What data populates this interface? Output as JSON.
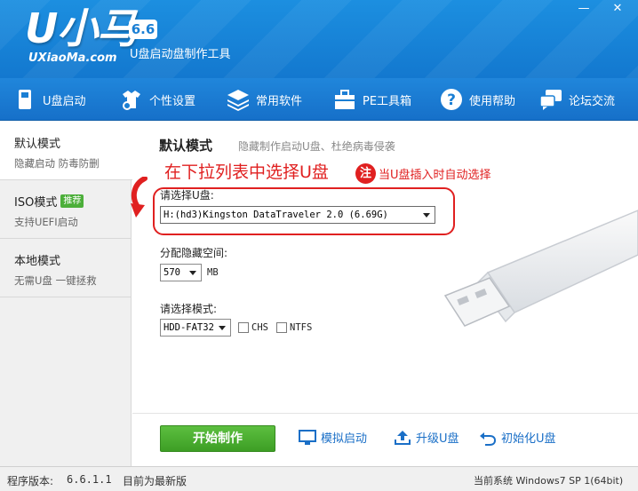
{
  "app": {
    "logo_text": "U小马",
    "version_badge": "6.6",
    "subtitle": "U盘启动盘制作工具",
    "url": "UXiaoMa.com"
  },
  "window": {
    "minimize": "—",
    "close": "✕"
  },
  "nav": [
    {
      "label": "U盘启动",
      "icon": "usb-drive-icon"
    },
    {
      "label": "个性设置",
      "icon": "shirt-gear-icon"
    },
    {
      "label": "常用软件",
      "icon": "layers-icon"
    },
    {
      "label": "PE工具箱",
      "icon": "toolbox-icon"
    },
    {
      "label": "使用帮助",
      "icon": "help-icon"
    },
    {
      "label": "论坛交流",
      "icon": "chat-icon"
    }
  ],
  "sidebar": [
    {
      "title": "默认模式",
      "sub": "隐藏启动 防毒防删",
      "active": true
    },
    {
      "title": "ISO模式",
      "badge": "推荐",
      "sub": "支持UEFI启动",
      "active": false
    },
    {
      "title": "本地模式",
      "sub": "无需U盘 一键拯救",
      "active": false
    }
  ],
  "content": {
    "title": "默认模式",
    "description": "隐藏制作启动U盘、杜绝病毒侵袭",
    "hint_main": "在下拉列表中选择U盘",
    "hint_dot": "注",
    "hint_note": "当U盘插入时自动选择",
    "drive_label": "请选择U盘:",
    "drive_value": "H:(hd3)Kingston DataTraveler 2.0 (6.69G)",
    "hidden_space_label": "分配隐藏空间:",
    "hidden_space_value": "570",
    "hidden_space_unit": "MB",
    "mode_label": "请选择模式:",
    "mode_value": "HDD-FAT32",
    "chs_label": "CHS",
    "ntfs_label": "NTFS",
    "chs_checked": false,
    "ntfs_checked": false
  },
  "actions": {
    "start": "开始制作",
    "simulate": "模拟启动",
    "upgrade": "升级U盘",
    "init": "初始化U盘"
  },
  "status": {
    "version_label": "程序版本:",
    "version": "6.6.1.1",
    "update": "目前为最新版",
    "system": "当前系统 Windows7 SP 1(64bit)"
  },
  "colors": {
    "header_blue": "#1a85db",
    "hint_red": "#e02020",
    "start_green": "#4cae32",
    "link_blue": "#1a6fc7"
  }
}
